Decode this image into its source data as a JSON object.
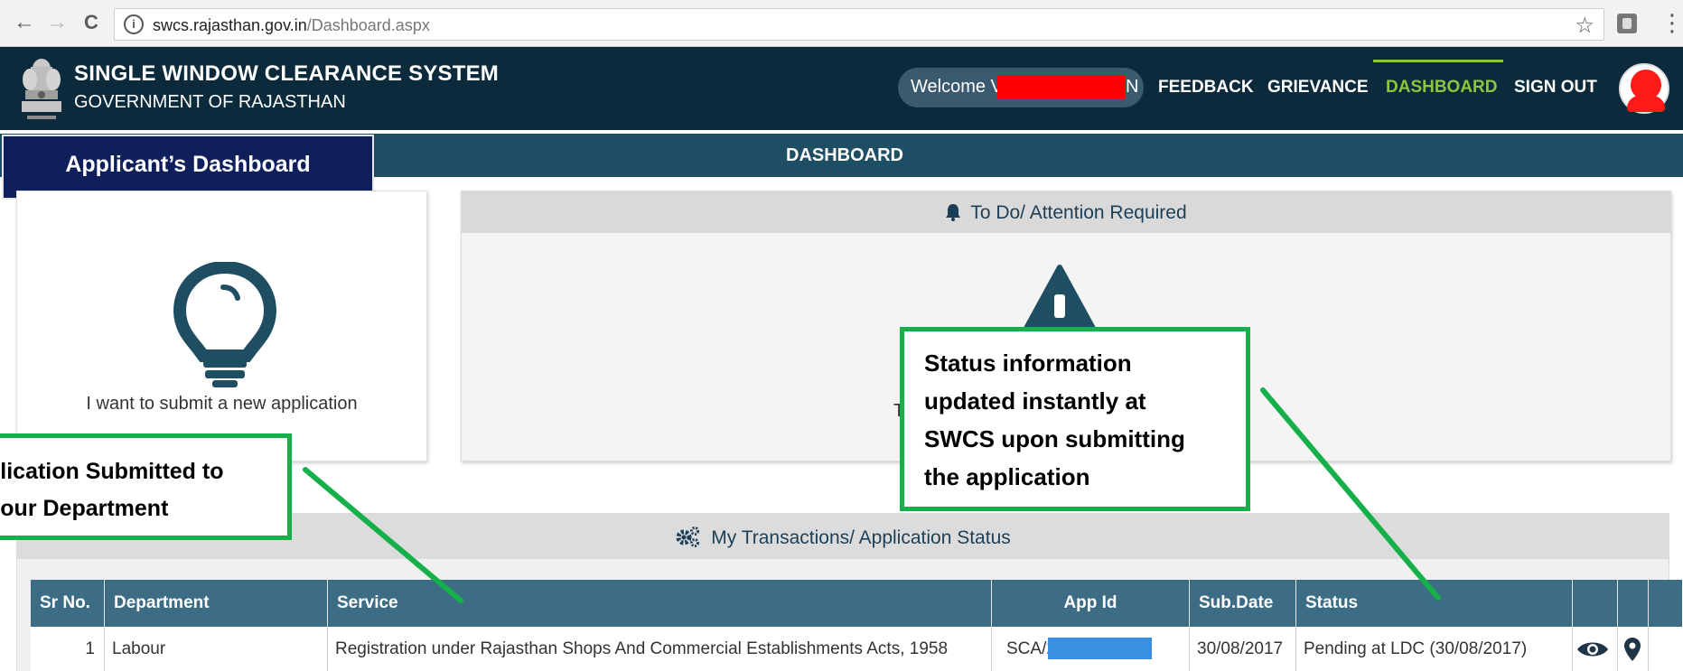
{
  "browser": {
    "url_host": "swcs.rajasthan.gov.in",
    "url_path": "/Dashboard.aspx",
    "back_glyph": "←",
    "forward_glyph": "→",
    "reload_glyph": "C",
    "info_glyph": "i",
    "star_glyph": "☆",
    "menu_glyph": "⋮"
  },
  "header": {
    "title": "SINGLE WINDOW CLEARANCE SYSTEM",
    "subtitle": "GOVERNMENT OF RAJASTHAN",
    "welcome_prefix": "Welcome V",
    "welcome_suffix": "N",
    "nav": {
      "feedback": "FEEDBACK",
      "grievance": "GRIEVANCE",
      "dashboard": "DASHBOARD",
      "signout": "SIGN OUT"
    },
    "active_color": "#8cc63f",
    "background_color": "#0b2b3c"
  },
  "dashboard": {
    "title": "DASHBOARD",
    "applicant_banner": "Applicant’s Dashboard"
  },
  "cards": {
    "new_application_label": "I want to submit a new application",
    "todo_title": "To Do/ Attention Required",
    "todo_partial_text": "T"
  },
  "transactions": {
    "title": "My Transactions/ Application Status",
    "columns": [
      "Sr No.",
      "Department",
      "Service",
      "App Id",
      "Sub.Date",
      "Status"
    ],
    "rows": [
      {
        "sr": "1",
        "department": "Labour",
        "service": "Registration under Rajasthan Shops And Commercial Establishments Acts, 1958",
        "app_id_visible": "SCA/20",
        "sub_date": "30/08/2017",
        "status": "Pending at LDC (30/08/2017)"
      }
    ]
  },
  "annotations": {
    "left_line1": "plication Submitted to",
    "left_line2": "bour Department",
    "right_line1": "Status information",
    "right_line2": "updated instantly at",
    "right_line3": "SWCS upon submitting",
    "right_line4": "the application",
    "border_color": "#16b04a"
  }
}
